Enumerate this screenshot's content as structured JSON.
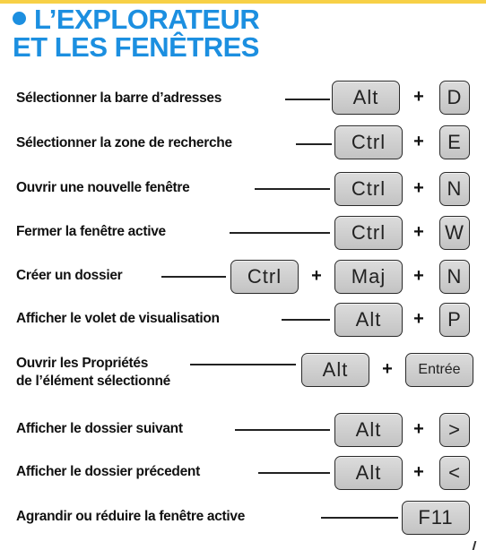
{
  "title": {
    "line1": "L’EXPLORATEUR",
    "line2": "ET LES FENÊTRES"
  },
  "shortcuts": [
    {
      "label": "Sélectionner la barre d’adresses",
      "keys": [
        "Alt",
        "D"
      ]
    },
    {
      "label": "Sélectionner la zone de recherche",
      "keys": [
        "Ctrl",
        "E"
      ]
    },
    {
      "label": "Ouvrir une nouvelle fenêtre",
      "keys": [
        "Ctrl",
        "N"
      ]
    },
    {
      "label": "Fermer la fenêtre active",
      "keys": [
        "Ctrl",
        "W"
      ]
    },
    {
      "label": "Créer un dossier",
      "keys": [
        "Ctrl",
        "Maj",
        "N"
      ]
    },
    {
      "label": "Afficher le volet de visualisation",
      "keys": [
        "Alt",
        "P"
      ]
    },
    {
      "label": "Ouvrir les Propriétés",
      "label2": "de l’élément sélectionné",
      "keys": [
        "Alt",
        "Entrée"
      ]
    },
    {
      "label": "Afficher le dossier suivant",
      "keys": [
        "Alt",
        ">"
      ]
    },
    {
      "label": "Afficher le dossier précedent",
      "keys": [
        "Alt",
        "<"
      ]
    },
    {
      "label": "Agrandir ou réduire la fenêtre active",
      "keys": [
        "F11"
      ]
    }
  ],
  "plus_sign": "+",
  "colors": {
    "title": "#1c8fe0",
    "key_fill": "#cfcfcf",
    "top_strip": "#f7d046"
  }
}
